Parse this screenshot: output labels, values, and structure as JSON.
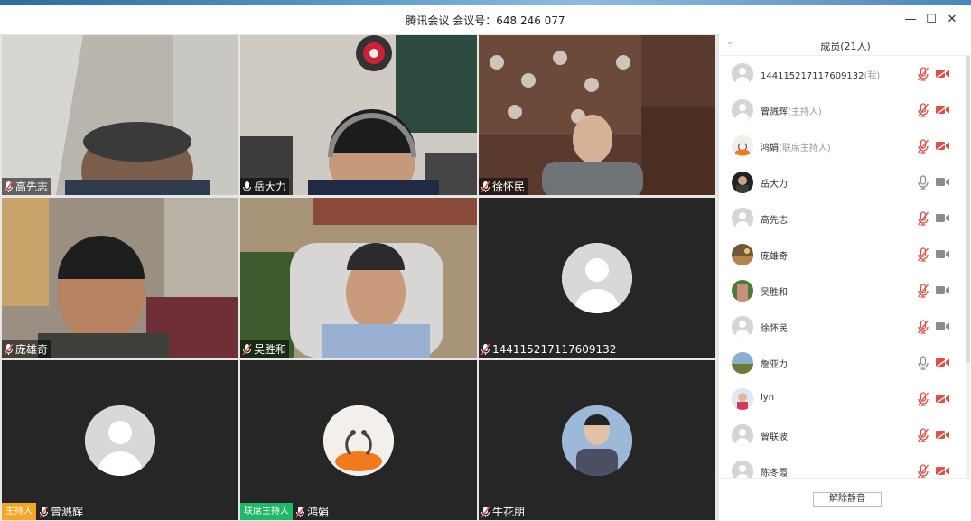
{
  "window": {
    "title": "腾讯会议 会议号：648 246 077",
    "controls": {
      "minimize": "—",
      "maximize": "☐",
      "close": "✕"
    }
  },
  "tiles": [
    {
      "name": "高先志",
      "type": "video"
    },
    {
      "name": "岳大力",
      "type": "video",
      "mic": "on"
    },
    {
      "name": "徐怀民",
      "type": "video"
    },
    {
      "name": "庞雄奇",
      "type": "video"
    },
    {
      "name": "吴胜和",
      "type": "video"
    },
    {
      "name": "144115217117609132",
      "type": "avatar"
    },
    {
      "name": "曾溅辉",
      "type": "avatar",
      "badge": "主持人",
      "badge_color": "#f5a623"
    },
    {
      "name": "鸿娟",
      "type": "avatar",
      "badge": "联席主持人",
      "badge_color": "#1fb868"
    },
    {
      "name": "牛花朋",
      "type": "avatar"
    }
  ],
  "panel": {
    "collapse_icon": "chevron-down",
    "title": "成员(21人)",
    "members": [
      {
        "name": "144115217117609132",
        "role": "(我)",
        "mic": "off",
        "cam": "off"
      },
      {
        "name": "曾溅辉",
        "role": "(主持人)",
        "mic": "off",
        "cam": "off"
      },
      {
        "name": "鸿娟",
        "role": "(联席主持人)",
        "mic": "off",
        "cam": "off"
      },
      {
        "name": "岳大力",
        "role": "",
        "mic": "on",
        "cam": "on"
      },
      {
        "name": "高先志",
        "role": "",
        "mic": "off",
        "cam": "on"
      },
      {
        "name": "庞雄奇",
        "role": "",
        "mic": "off",
        "cam": "on"
      },
      {
        "name": "吴胜和",
        "role": "",
        "mic": "off",
        "cam": "on"
      },
      {
        "name": "徐怀民",
        "role": "",
        "mic": "off",
        "cam": "on"
      },
      {
        "name": "詹亚力",
        "role": "",
        "mic": "on",
        "cam": "off"
      },
      {
        "name": "lyn",
        "role": "",
        "mic": "off",
        "cam": "off"
      },
      {
        "name": "曾联波",
        "role": "",
        "mic": "off",
        "cam": "off"
      },
      {
        "name": "陈冬霞",
        "role": "",
        "mic": "off",
        "cam": "off"
      }
    ],
    "mute_all_label": "解除静音"
  },
  "colors": {
    "mic_off": "#e0504a",
    "icon_gray": "#8c8c8c",
    "host_badge": "#f5a623",
    "cohost_badge": "#1fb868"
  }
}
